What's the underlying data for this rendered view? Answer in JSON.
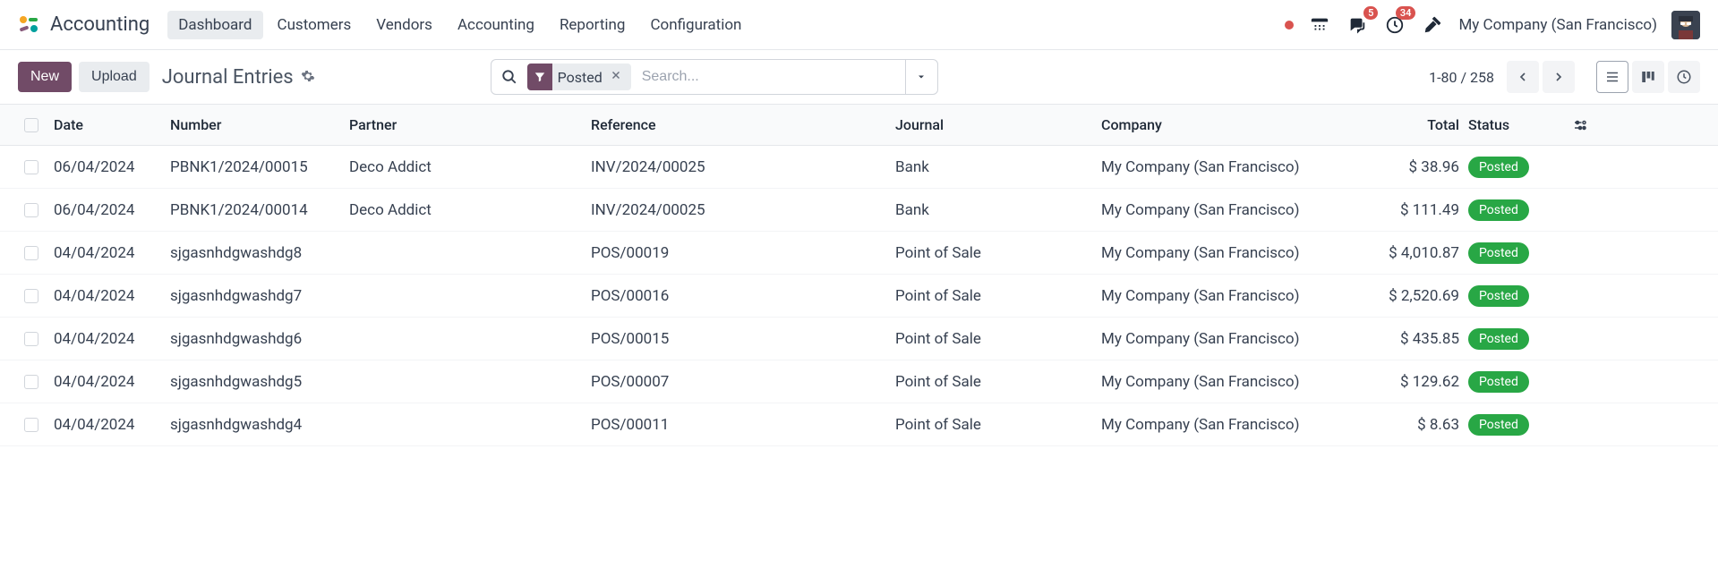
{
  "app": {
    "title": "Accounting"
  },
  "menu": {
    "items": [
      {
        "label": "Dashboard",
        "active": true
      },
      {
        "label": "Customers",
        "active": false
      },
      {
        "label": "Vendors",
        "active": false
      },
      {
        "label": "Accounting",
        "active": false
      },
      {
        "label": "Reporting",
        "active": false
      },
      {
        "label": "Configuration",
        "active": false
      }
    ]
  },
  "topbar": {
    "messages_badge": "5",
    "activities_badge": "34",
    "company": "My Company (San Francisco)"
  },
  "controls": {
    "new_label": "New",
    "upload_label": "Upload",
    "view_title": "Journal Entries",
    "filter_chip": "Posted",
    "search_placeholder": "Search...",
    "pager": "1-80 / 258"
  },
  "table": {
    "headers": {
      "date": "Date",
      "number": "Number",
      "partner": "Partner",
      "reference": "Reference",
      "journal": "Journal",
      "company": "Company",
      "total": "Total",
      "status": "Status"
    },
    "rows": [
      {
        "date": "06/04/2024",
        "number": "PBNK1/2024/00015",
        "partner": "Deco Addict",
        "reference": "INV/2024/00025",
        "journal": "Bank",
        "company": "My Company (San Francisco)",
        "total": "$ 38.96",
        "status": "Posted"
      },
      {
        "date": "06/04/2024",
        "number": "PBNK1/2024/00014",
        "partner": "Deco Addict",
        "reference": "INV/2024/00025",
        "journal": "Bank",
        "company": "My Company (San Francisco)",
        "total": "$ 111.49",
        "status": "Posted"
      },
      {
        "date": "04/04/2024",
        "number": "sjgasnhdgwashdg8",
        "partner": "",
        "reference": "POS/00019",
        "journal": "Point of Sale",
        "company": "My Company (San Francisco)",
        "total": "$ 4,010.87",
        "status": "Posted"
      },
      {
        "date": "04/04/2024",
        "number": "sjgasnhdgwashdg7",
        "partner": "",
        "reference": "POS/00016",
        "journal": "Point of Sale",
        "company": "My Company (San Francisco)",
        "total": "$ 2,520.69",
        "status": "Posted"
      },
      {
        "date": "04/04/2024",
        "number": "sjgasnhdgwashdg6",
        "partner": "",
        "reference": "POS/00015",
        "journal": "Point of Sale",
        "company": "My Company (San Francisco)",
        "total": "$ 435.85",
        "status": "Posted"
      },
      {
        "date": "04/04/2024",
        "number": "sjgasnhdgwashdg5",
        "partner": "",
        "reference": "POS/00007",
        "journal": "Point of Sale",
        "company": "My Company (San Francisco)",
        "total": "$ 129.62",
        "status": "Posted"
      },
      {
        "date": "04/04/2024",
        "number": "sjgasnhdgwashdg4",
        "partner": "",
        "reference": "POS/00011",
        "journal": "Point of Sale",
        "company": "My Company (San Francisco)",
        "total": "$ 8.63",
        "status": "Posted"
      }
    ]
  }
}
